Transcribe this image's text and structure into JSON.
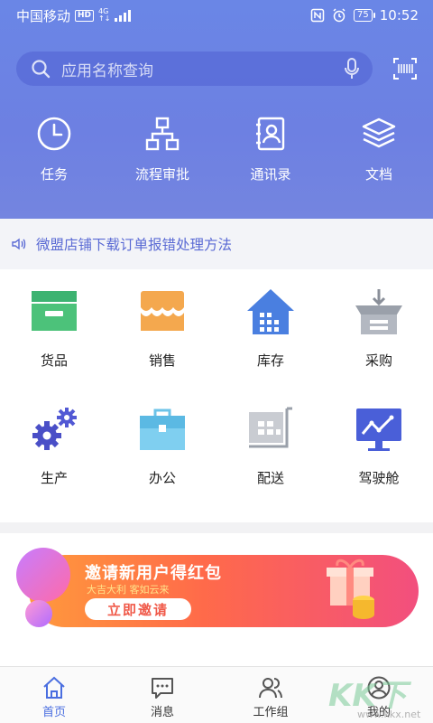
{
  "statusbar": {
    "carrier": "中国移动",
    "hd": "HD",
    "net_top": "4G",
    "net_bot": "↑↓",
    "battery": "75",
    "time": "10:52"
  },
  "search": {
    "placeholder": "应用名称查询"
  },
  "quick": [
    {
      "label": "任务",
      "icon": "clock-icon"
    },
    {
      "label": "流程审批",
      "icon": "flowchart-icon"
    },
    {
      "label": "通讯录",
      "icon": "contacts-icon"
    },
    {
      "label": "文档",
      "icon": "layers-icon"
    }
  ],
  "notice": {
    "text": "微盟店铺下载订单报错处理方法"
  },
  "grid": [
    {
      "label": "货品",
      "icon": "goods-box-icon"
    },
    {
      "label": "销售",
      "icon": "shop-awning-icon"
    },
    {
      "label": "库存",
      "icon": "warehouse-icon"
    },
    {
      "label": "采购",
      "icon": "purchase-box-icon"
    },
    {
      "label": "生产",
      "icon": "gears-icon"
    },
    {
      "label": "办公",
      "icon": "briefcase-icon"
    },
    {
      "label": "配送",
      "icon": "delivery-cart-icon"
    },
    {
      "label": "驾驶舱",
      "icon": "dashboard-monitor-icon"
    }
  ],
  "banner": {
    "title": "邀请新用户得红包",
    "subtitle": "大吉大利  客如云来",
    "cta": "立即邀请"
  },
  "tabs": [
    {
      "label": "首页",
      "icon": "home-icon",
      "active": true
    },
    {
      "label": "消息",
      "icon": "message-icon",
      "active": false
    },
    {
      "label": "工作组",
      "icon": "group-icon",
      "active": false
    },
    {
      "label": "我的",
      "icon": "user-icon",
      "active": false
    }
  ],
  "watermark": {
    "logo": "KK下载",
    "url": "www.kkx.net"
  },
  "colors": {
    "accent": "#4a6ee0",
    "hero": "#6a86e6",
    "notice_text": "#5a6ad4",
    "banner_start": "#ff9a3c",
    "banner_end": "#f24f7e"
  }
}
